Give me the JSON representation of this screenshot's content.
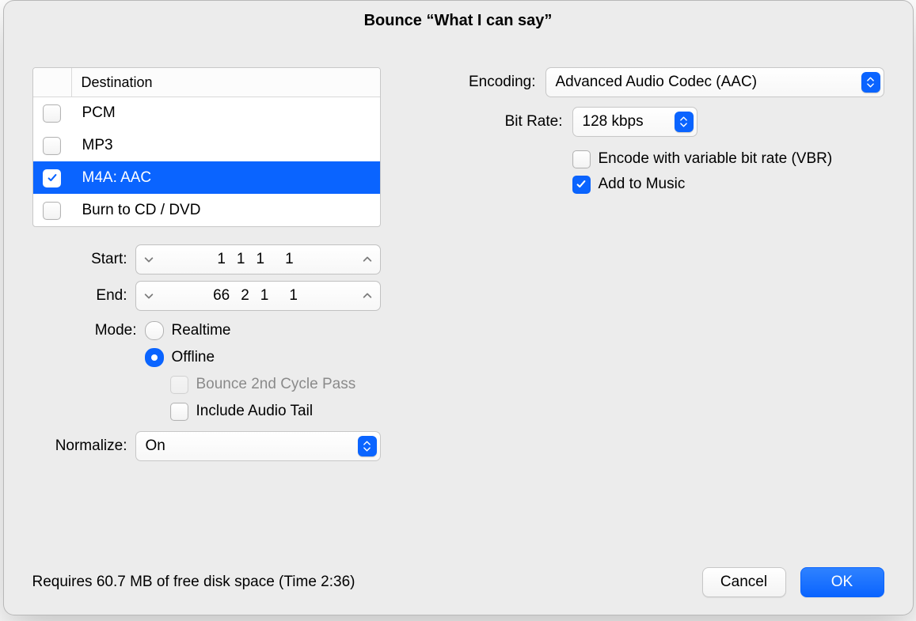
{
  "title": "Bounce “What I can say”",
  "left": {
    "destination": {
      "header": "Destination",
      "rows": [
        {
          "label": "PCM",
          "checked": false,
          "selected": false
        },
        {
          "label": "MP3",
          "checked": false,
          "selected": false
        },
        {
          "label": "M4A: AAC",
          "checked": true,
          "selected": true
        },
        {
          "label": "Burn to CD / DVD",
          "checked": false,
          "selected": false
        }
      ]
    },
    "start": {
      "label": "Start:",
      "v1": "1",
      "v2": "1",
      "v3": "1",
      "v4": "1"
    },
    "end": {
      "label": "End:",
      "v1": "66",
      "v2": "2",
      "v3": "1",
      "v4": "1"
    },
    "mode": {
      "label": "Mode:",
      "options": [
        {
          "label": "Realtime",
          "selected": false
        },
        {
          "label": "Offline",
          "selected": true
        }
      ],
      "bounce2nd": {
        "label": "Bounce 2nd Cycle Pass",
        "checked": false,
        "disabled": true
      },
      "includeTail": {
        "label": "Include Audio Tail",
        "checked": false
      }
    },
    "normalize": {
      "label": "Normalize:",
      "value": "On"
    }
  },
  "right": {
    "encoding": {
      "label": "Encoding:",
      "value": "Advanced Audio Codec (AAC)"
    },
    "bitrate": {
      "label": "Bit Rate:",
      "value": "128 kbps"
    },
    "vbr": {
      "label": "Encode with variable bit rate (VBR)",
      "checked": false
    },
    "addToMusic": {
      "label": "Add to Music",
      "checked": true
    }
  },
  "footer": {
    "requires": "Requires 60.7 MB of free disk space  (Time 2:36)",
    "cancel": "Cancel",
    "ok": "OK"
  }
}
